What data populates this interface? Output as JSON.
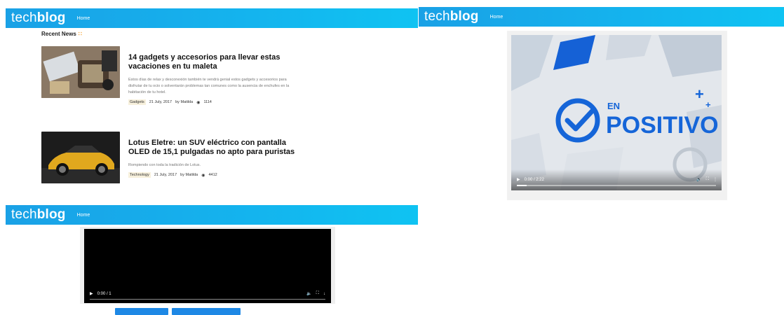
{
  "brand": {
    "tech": "tech",
    "blog": "blog"
  },
  "nav": {
    "home": "Home"
  },
  "recent": {
    "title": "Recent News",
    "articles": [
      {
        "title": "14 gadgets y accesorios para llevar estas vacaciones en tu maleta",
        "excerpt": "Estos días de relax y desconexión también te vendrá genial estos gadgets y accesorios para disfrutar de tu ocio o solventarán problemas tan comunes como la ausencia de enchufes en la habitación de tu hotel.",
        "category": "Gadgets",
        "date": "21 July, 2017",
        "author": "by Matilda",
        "views": "1114"
      },
      {
        "title": "Lotus Eletre: un SUV eléctrico con pantalla OLED de 15,1 pulgadas no apto para puristas",
        "excerpt": "Rompiendo con toda la tradición de Lotus.",
        "category": "Technology",
        "date": "21 July, 2017",
        "author": "by Matilda",
        "views": "4412"
      }
    ]
  },
  "video_player": {
    "logo_en": "EN",
    "logo_positivo": "POSITIVO",
    "time": "0:00 / 2:22",
    "progress": 0.05
  },
  "video_player_2": {
    "time": "0:00 / 1"
  },
  "colors": {
    "topbar": "#1aa1e6",
    "accent": "#1e88e5",
    "rss": "#f49a23",
    "logo_blue": "#1565d8"
  },
  "icons": [
    "rss-icon",
    "eye-icon",
    "play-icon",
    "volume-icon",
    "fullscreen-icon",
    "more-icon",
    "download-icon"
  ]
}
